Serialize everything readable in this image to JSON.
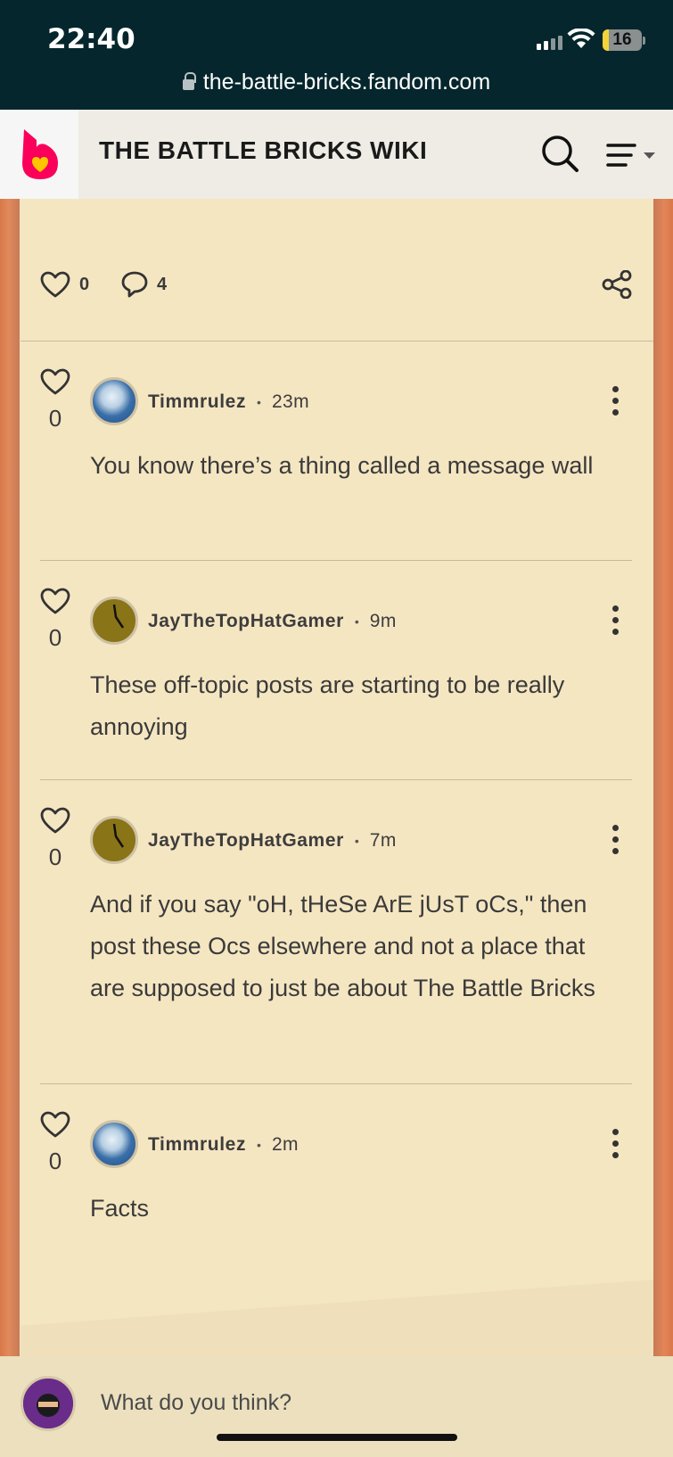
{
  "status_bar": {
    "time": "22:40",
    "battery": "16"
  },
  "url_bar": {
    "domain": "the-battle-bricks.fandom.com"
  },
  "header": {
    "title": "THE BATTLE BRICKS WIKI"
  },
  "post_actions": {
    "likes": "0",
    "comments": "4"
  },
  "comments": [
    {
      "user": "Timmrulez",
      "time": "23m",
      "likes": "0",
      "text": "You know there’s a thing called a message wall"
    },
    {
      "user": "JayTheTopHatGamer",
      "time": "9m",
      "likes": "0",
      "text": "These off-topic posts are starting to be really annoying"
    },
    {
      "user": "JayTheTopHatGamer",
      "time": "7m",
      "likes": "0",
      "text": "And if you say \"oH, tHeSe ArE jUsT oCs,\" then post these Ocs elsewhere and not a place that are supposed to just be about The Battle Bricks"
    },
    {
      "user": "Timmrulez",
      "time": "2m",
      "likes": "0",
      "text": "Facts"
    }
  ],
  "composer": {
    "placeholder": "What do you think?"
  },
  "colors": {
    "brand": "#fa005a",
    "card": "#f5e6c2",
    "topbar": "#04262c"
  }
}
